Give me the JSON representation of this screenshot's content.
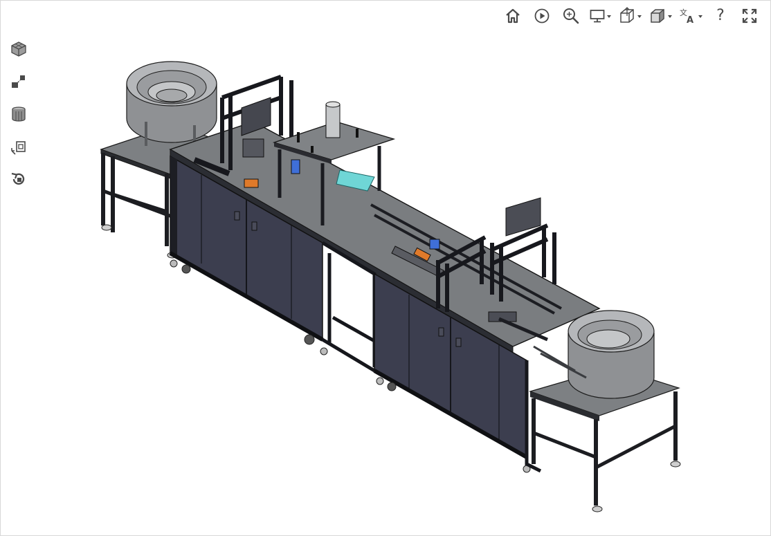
{
  "app": {
    "title": ""
  },
  "toolbar": {
    "items": [
      {
        "name": "home-view",
        "icon": "home-icon"
      },
      {
        "name": "animation",
        "icon": "play-circle-icon"
      },
      {
        "name": "zoom-fit",
        "icon": "zoom-icon"
      },
      {
        "name": "display-style",
        "icon": "monitor-icon",
        "dropdown": true
      },
      {
        "name": "section-view",
        "icon": "section-cube-icon",
        "dropdown": true
      },
      {
        "name": "standard-views",
        "icon": "view-cube-icon",
        "dropdown": true
      },
      {
        "name": "language",
        "icon": "translate-icon",
        "dropdown": true
      },
      {
        "name": "help",
        "icon": "help-icon",
        "label": "?"
      },
      {
        "name": "fullscreen",
        "icon": "fullscreen-icon"
      }
    ]
  },
  "left_tools": [
    {
      "name": "model-tree",
      "icon": "assembly-cube-icon"
    },
    {
      "name": "explode",
      "icon": "explode-icon"
    },
    {
      "name": "cross-section",
      "icon": "cross-section-icon"
    },
    {
      "name": "measure",
      "icon": "measure-icon"
    },
    {
      "name": "reset-view",
      "icon": "reset-rotate-icon"
    }
  ],
  "model": {
    "subject": "assembly-machine-3d-model"
  },
  "colors": {
    "icon": "#4a4a4a",
    "frame_dark": "#1f2127",
    "cabinet": "#3b3d4d",
    "tabletop": "#7c7f82",
    "bowl": "#a3a5a8",
    "accent_cyan": "#6fd6d6",
    "accent_orange": "#e07a2a",
    "accent_blue": "#3f6fd8"
  }
}
